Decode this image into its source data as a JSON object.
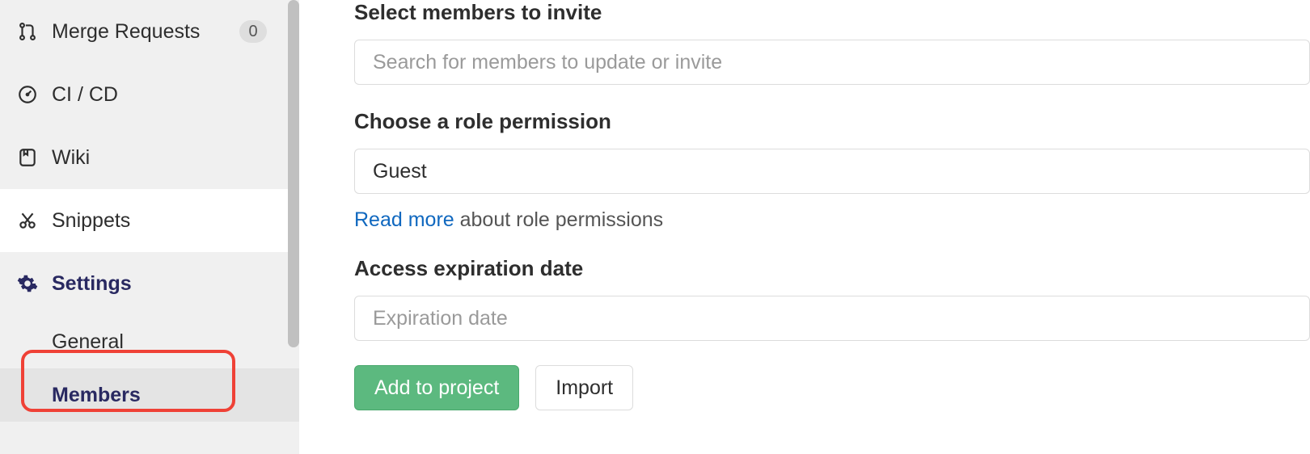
{
  "sidebar": {
    "items": [
      {
        "label": "Merge Requests",
        "badge": "0"
      },
      {
        "label": "CI / CD"
      },
      {
        "label": "Wiki"
      },
      {
        "label": "Snippets"
      },
      {
        "label": "Settings"
      }
    ],
    "settings_sub": [
      {
        "label": "General"
      },
      {
        "label": "Members"
      }
    ]
  },
  "form": {
    "select_members_label": "Select members to invite",
    "search_placeholder": "Search for members to update or invite",
    "role_label": "Choose a role permission",
    "role_value": "Guest",
    "readmore_link": "Read more",
    "readmore_text": " about role permissions",
    "expiration_label": "Access expiration date",
    "expiration_placeholder": "Expiration date",
    "add_button": "Add to project",
    "import_button": "Import"
  }
}
